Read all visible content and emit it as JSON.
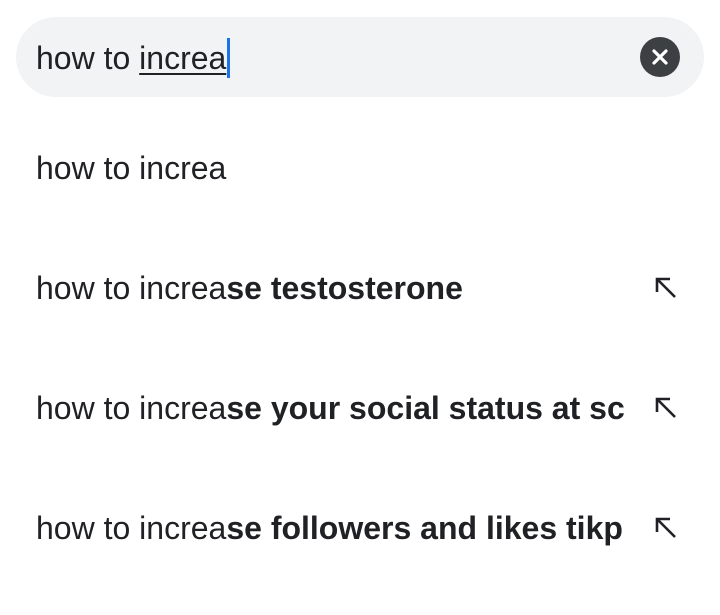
{
  "search": {
    "query_prefix": "how to ",
    "query_composing": "increa",
    "clear_icon": "close-icon"
  },
  "suggestions": [
    {
      "typed": "how to increa",
      "completion": "",
      "has_fill_arrow": false
    },
    {
      "typed": "how to increa",
      "completion": "se testosterone",
      "has_fill_arrow": true
    },
    {
      "typed": "how to increa",
      "completion": "se your social status at school",
      "has_fill_arrow": true
    },
    {
      "typed": "how to increa",
      "completion": "se followers and likes tikplus",
      "has_fill_arrow": true
    }
  ],
  "icons": {
    "fill_arrow": "arrow-up-left-icon"
  },
  "colors": {
    "search_bg": "#f1f3f4",
    "caret": "#1a73e8",
    "clear_button": "#3c4043",
    "text": "#202124"
  }
}
